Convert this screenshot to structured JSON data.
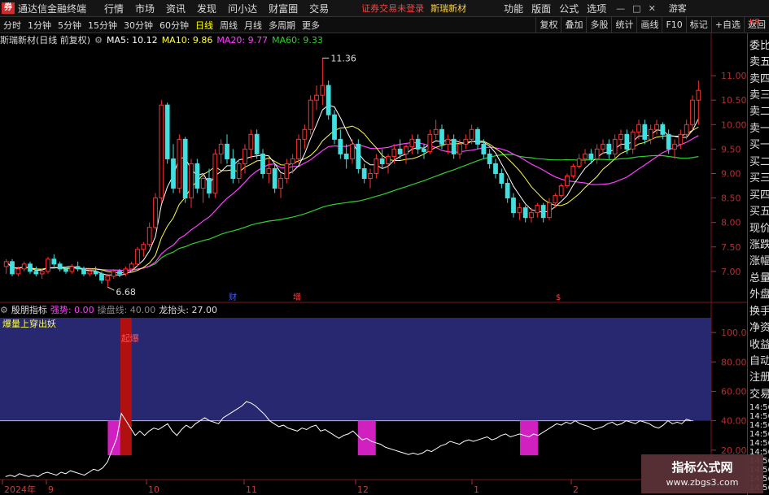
{
  "app": {
    "logo": "券",
    "title": "通达信金融终端"
  },
  "menu": [
    "行情",
    "市场",
    "资讯",
    "发现",
    "问小达",
    "财富圈",
    "交易"
  ],
  "status": {
    "text": "证券交易未登录",
    "stock": "斯瑞新材"
  },
  "right_menu": [
    "功能",
    "版面",
    "公式",
    "选项"
  ],
  "window_controls": {
    "min": "—",
    "max": "□",
    "close": "✕"
  },
  "guest": "游客",
  "periods": [
    "分时",
    "1分钟",
    "5分钟",
    "15分钟",
    "30分钟",
    "60分钟",
    "日线",
    "周线",
    "月线",
    "多周期",
    "更多"
  ],
  "active_period": "日线",
  "toolbar_right": [
    "复权",
    "叠加",
    "多股",
    "统计",
    "画线",
    "F10",
    "标记",
    "+自选",
    "返回"
  ],
  "price_info": {
    "stock_label": "斯瑞新材(日线 前复权)",
    "ma5": "MA5: 10.12",
    "ma10": "MA10: 9.86",
    "ma20": "MA20: 9.77",
    "ma60": "MA60: 9.33"
  },
  "indicator": {
    "name": "殷朋指标",
    "strength": "强势: 0.00",
    "line": "操盘线: 40.00",
    "dragon": "龙抬头: 27.00",
    "title": "爆量上穿出妖",
    "signal": "起爆"
  },
  "sidebar": {
    "items": [
      "委比",
      "卖五",
      "卖四",
      "卖三",
      "卖二",
      "卖一",
      "买一",
      "买二",
      "买三",
      "买四",
      "买五",
      "现价",
      "涨跌",
      "涨幅",
      "总量",
      "外盘",
      "换手",
      "净资",
      "收益",
      "自动",
      "注册",
      "交易"
    ],
    "times": [
      "14:56",
      "14:56",
      "14:56",
      "14:56",
      "14:56",
      "14:56",
      "14:56",
      "14:56",
      "14:56",
      "14:56"
    ],
    "kr": "KR"
  },
  "chart_labels": {
    "high": "11.36",
    "low": "6.68",
    "mark_cai": "财",
    "mark_zeng": "增",
    "mark_s": "$"
  },
  "date_ticks": [
    "2024年",
    "9",
    "10",
    "11",
    "12",
    "1",
    "2"
  ],
  "watermark": {
    "main": "指标公式网",
    "sub": "www.zbgs3.com"
  },
  "colors": {
    "up": "#ff3030",
    "down": "#40e0e0",
    "ma5": "#ffffff",
    "ma10": "#ffff40",
    "ma20": "#ff40ff",
    "ma60": "#30d030",
    "bg": "#000000",
    "ind_bg": "#282870"
  },
  "chart_data": [
    {
      "type": "candlestick",
      "title": "斯瑞新材(日线 前复权)",
      "ylim": [
        6.4,
        11.6
      ],
      "yticks": [
        7.0,
        7.5,
        8.0,
        8.5,
        9.0,
        9.5,
        10.0,
        10.5,
        11.0
      ],
      "ohlc": [
        [
          7.1,
          7.25,
          6.95,
          7.2
        ],
        [
          7.2,
          7.25,
          6.9,
          6.95
        ],
        [
          6.95,
          7.1,
          6.9,
          7.05
        ],
        [
          7.05,
          7.2,
          7.0,
          7.15
        ],
        [
          7.15,
          7.2,
          6.95,
          7.0
        ],
        [
          7.0,
          7.1,
          6.9,
          6.95
        ],
        [
          6.95,
          7.05,
          6.85,
          7.0
        ],
        [
          7.0,
          7.3,
          6.95,
          7.25
        ],
        [
          7.25,
          7.35,
          7.1,
          7.15
        ],
        [
          7.15,
          7.2,
          7.0,
          7.05
        ],
        [
          7.05,
          7.1,
          6.95,
          7.0
        ],
        [
          7.0,
          7.15,
          6.95,
          7.1
        ],
        [
          7.1,
          7.2,
          7.0,
          7.05
        ],
        [
          7.05,
          7.1,
          6.9,
          6.95
        ],
        [
          6.95,
          7.05,
          6.9,
          7.0
        ],
        [
          7.0,
          7.1,
          6.9,
          6.95
        ],
        [
          6.95,
          7.0,
          6.75,
          6.82
        ],
        [
          6.82,
          6.95,
          6.68,
          6.9
        ],
        [
          6.9,
          7.05,
          6.85,
          7.0
        ],
        [
          7.0,
          7.05,
          6.88,
          6.95
        ],
        [
          6.95,
          7.1,
          6.9,
          7.05
        ],
        [
          7.05,
          7.2,
          7.0,
          7.15
        ],
        [
          7.15,
          7.5,
          7.1,
          7.45
        ],
        [
          7.45,
          7.6,
          7.3,
          7.55
        ],
        [
          7.55,
          8.0,
          7.5,
          7.9
        ],
        [
          7.9,
          8.6,
          7.85,
          8.5
        ],
        [
          8.5,
          10.5,
          8.4,
          10.4
        ],
        [
          10.4,
          10.45,
          9.2,
          9.3
        ],
        [
          9.3,
          9.6,
          8.6,
          8.7
        ],
        [
          8.7,
          9.8,
          8.6,
          9.7
        ],
        [
          9.7,
          9.75,
          8.4,
          8.5
        ],
        [
          8.5,
          9.3,
          8.3,
          9.2
        ],
        [
          9.2,
          9.3,
          8.6,
          8.7
        ],
        [
          8.7,
          9.0,
          8.4,
          8.9
        ],
        [
          8.9,
          9.1,
          8.5,
          8.6
        ],
        [
          8.6,
          9.5,
          8.5,
          9.4
        ],
        [
          9.4,
          9.7,
          9.2,
          9.6
        ],
        [
          9.6,
          9.8,
          9.2,
          9.3
        ],
        [
          9.3,
          9.5,
          8.8,
          8.9
        ],
        [
          8.9,
          9.3,
          8.8,
          9.2
        ],
        [
          9.2,
          9.6,
          9.0,
          9.5
        ],
        [
          9.5,
          9.9,
          9.3,
          9.8
        ],
        [
          9.8,
          9.9,
          9.3,
          9.4
        ],
        [
          9.4,
          9.5,
          8.9,
          9.0
        ],
        [
          9.0,
          9.3,
          8.8,
          9.1
        ],
        [
          9.1,
          9.2,
          8.6,
          8.7
        ],
        [
          8.7,
          9.0,
          8.5,
          8.9
        ],
        [
          8.9,
          9.3,
          8.8,
          9.2
        ],
        [
          9.2,
          9.4,
          9.0,
          9.3
        ],
        [
          9.3,
          9.8,
          9.2,
          9.7
        ],
        [
          9.7,
          10.0,
          9.5,
          9.9
        ],
        [
          9.9,
          10.6,
          9.8,
          10.5
        ],
        [
          10.5,
          10.8,
          10.3,
          10.6
        ],
        [
          10.6,
          11.36,
          10.4,
          10.8
        ],
        [
          10.8,
          10.9,
          10.1,
          10.2
        ],
        [
          10.2,
          10.3,
          9.6,
          9.7
        ],
        [
          9.7,
          9.9,
          9.3,
          9.4
        ],
        [
          9.4,
          9.6,
          9.1,
          9.3
        ],
        [
          9.3,
          9.7,
          9.2,
          9.6
        ],
        [
          9.6,
          9.7,
          9.0,
          9.1
        ],
        [
          9.1,
          9.2,
          8.8,
          8.9
        ],
        [
          8.9,
          9.1,
          8.7,
          9.0
        ],
        [
          9.0,
          9.4,
          8.9,
          9.3
        ],
        [
          9.3,
          9.5,
          9.1,
          9.2
        ],
        [
          9.2,
          9.4,
          9.0,
          9.35
        ],
        [
          9.35,
          9.6,
          9.2,
          9.5
        ],
        [
          9.5,
          9.7,
          9.3,
          9.4
        ],
        [
          9.4,
          9.6,
          9.2,
          9.55
        ],
        [
          9.55,
          9.8,
          9.4,
          9.7
        ],
        [
          9.7,
          9.8,
          9.4,
          9.5
        ],
        [
          9.5,
          9.6,
          9.3,
          9.45
        ],
        [
          9.45,
          9.9,
          9.4,
          9.8
        ],
        [
          9.8,
          10.1,
          9.7,
          9.9
        ],
        [
          9.9,
          10.0,
          9.5,
          9.6
        ],
        [
          9.6,
          9.8,
          9.4,
          9.7
        ],
        [
          9.7,
          9.8,
          9.3,
          9.4
        ],
        [
          9.4,
          9.7,
          9.3,
          9.6
        ],
        [
          9.6,
          9.8,
          9.5,
          9.7
        ],
        [
          9.7,
          10.0,
          9.6,
          9.9
        ],
        [
          9.9,
          9.95,
          9.5,
          9.6
        ],
        [
          9.6,
          9.7,
          9.3,
          9.4
        ],
        [
          9.4,
          9.5,
          9.1,
          9.2
        ],
        [
          9.2,
          9.3,
          8.9,
          9.0
        ],
        [
          9.0,
          9.1,
          8.7,
          8.8
        ],
        [
          8.8,
          8.9,
          8.4,
          8.5
        ],
        [
          8.5,
          8.6,
          8.1,
          8.2
        ],
        [
          8.2,
          8.4,
          8.05,
          8.3
        ],
        [
          8.3,
          8.35,
          8.0,
          8.1
        ],
        [
          8.1,
          8.3,
          8.0,
          8.2
        ],
        [
          8.2,
          8.4,
          8.1,
          8.35
        ],
        [
          8.35,
          8.4,
          8.0,
          8.1
        ],
        [
          8.1,
          8.5,
          8.05,
          8.4
        ],
        [
          8.4,
          8.6,
          8.3,
          8.55
        ],
        [
          8.55,
          8.8,
          8.5,
          8.75
        ],
        [
          8.75,
          9.0,
          8.7,
          8.95
        ],
        [
          8.95,
          9.2,
          8.9,
          9.15
        ],
        [
          9.15,
          9.4,
          9.1,
          9.3
        ],
        [
          9.3,
          9.5,
          9.2,
          9.4
        ],
        [
          9.4,
          9.5,
          9.2,
          9.3
        ],
        [
          9.3,
          9.6,
          9.2,
          9.5
        ],
        [
          9.5,
          9.7,
          9.4,
          9.6
        ],
        [
          9.6,
          9.7,
          9.3,
          9.4
        ],
        [
          9.4,
          9.8,
          9.3,
          9.7
        ],
        [
          9.7,
          9.9,
          9.5,
          9.8
        ],
        [
          9.8,
          9.9,
          9.4,
          9.5
        ],
        [
          9.5,
          9.9,
          9.4,
          9.85
        ],
        [
          9.85,
          10.1,
          9.7,
          10.0
        ],
        [
          10.0,
          10.1,
          9.6,
          9.7
        ],
        [
          9.7,
          10.0,
          9.6,
          9.9
        ],
        [
          9.9,
          10.1,
          9.8,
          10.0
        ],
        [
          10.0,
          10.05,
          9.7,
          9.8
        ],
        [
          9.8,
          9.9,
          9.4,
          9.5
        ],
        [
          9.5,
          9.7,
          9.3,
          9.6
        ],
        [
          9.6,
          9.9,
          9.5,
          9.8
        ],
        [
          9.8,
          10.1,
          9.7,
          10.0
        ],
        [
          10.0,
          10.6,
          9.9,
          10.5
        ],
        [
          10.5,
          10.9,
          10.0,
          10.7
        ]
      ],
      "ma_note": "MA5/MA10/MA20/MA60"
    },
    {
      "type": "line",
      "title": "殷朋指标",
      "ylim": [
        0,
        110
      ],
      "yticks": [
        20.0,
        40.0,
        60.0,
        80.0,
        100.0
      ],
      "threshold": 40,
      "series": [
        {
          "name": "操盘线",
          "values": [
            2,
            3,
            2,
            4,
            3,
            2,
            3,
            2,
            4,
            5,
            4,
            3,
            5,
            4,
            6,
            5,
            4,
            3,
            5,
            7,
            6,
            8,
            12,
            20,
            28,
            45,
            40,
            35,
            30,
            33,
            30,
            33,
            35,
            34,
            36,
            38,
            33,
            30,
            34,
            37,
            35,
            38,
            40,
            42,
            40,
            39,
            38,
            42,
            44,
            46,
            48,
            50,
            53,
            52,
            50,
            47,
            44,
            40,
            38,
            36,
            37,
            35,
            34,
            33,
            35,
            34,
            36,
            37,
            33,
            34,
            32,
            30,
            28,
            30,
            31,
            33,
            30,
            27,
            28,
            26,
            25,
            24,
            22,
            21,
            20,
            19,
            18,
            17,
            18,
            17,
            18,
            20,
            19,
            21,
            23,
            24,
            26,
            25,
            24,
            26,
            27,
            26,
            27,
            28,
            29,
            27,
            28,
            30,
            31,
            29,
            30,
            31,
            30,
            29,
            31,
            30,
            32,
            34,
            36,
            38,
            37,
            39,
            38,
            40,
            38,
            37,
            36,
            34,
            35,
            36,
            38,
            39,
            37,
            38,
            40,
            39,
            38,
            40,
            39,
            38,
            36,
            35,
            37,
            40,
            38,
            39,
            38,
            41,
            40
          ]
        }
      ],
      "bars": [
        {
          "name": "强势",
          "x_index": 24,
          "top": 40,
          "color": "#d020c0"
        },
        {
          "name": "起爆",
          "x_index": 26,
          "top": 110,
          "color": "#b01010"
        },
        {
          "name": "强势",
          "x_index": 78,
          "top": 40,
          "color": "#d020c0"
        },
        {
          "name": "强势",
          "x_index": 113,
          "top": 40,
          "color": "#d020c0"
        }
      ]
    }
  ]
}
